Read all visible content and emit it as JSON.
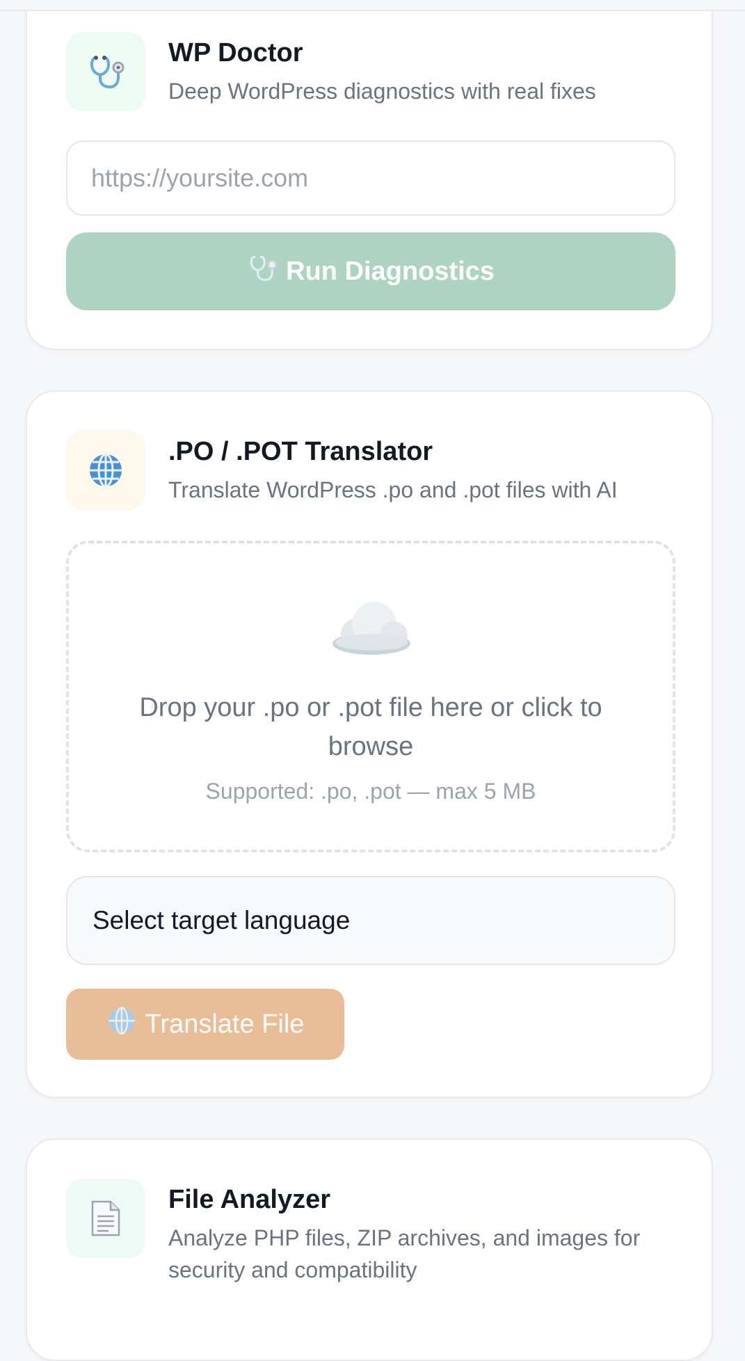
{
  "wp_doctor": {
    "title": "WP Doctor",
    "description": "Deep WordPress diagnostics with real fixes",
    "url_placeholder": "https://yoursite.com",
    "url_value": "",
    "run_label": "Run Diagnostics",
    "icon": "stethoscope-icon",
    "accent_color": "#aed3c3"
  },
  "po_translator": {
    "title": ".PO / .POT Translator",
    "description": "Translate WordPress .po and .pot files with AI",
    "drop_text": "Drop your .po or .pot file here or click to browse",
    "drop_sub": "Supported: .po, .pot — max 5 MB",
    "language_select": "Select target language",
    "translate_label": "Translate File",
    "icon": "globe-icon",
    "upload_icon": "cloud-icon",
    "accent_color": "#e9be96"
  },
  "file_analyzer": {
    "title": "File Analyzer",
    "description": "Analyze PHP files, ZIP archives, and images for security and compatibility",
    "icon": "document-icon"
  }
}
